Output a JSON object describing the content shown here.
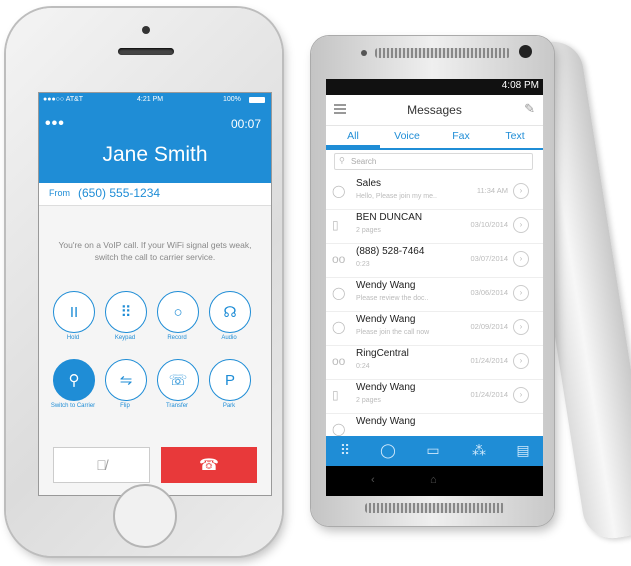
{
  "iphone": {
    "status": {
      "carrier": "●●●○○ AT&T",
      "time": "4:21 PM",
      "battery": "100%"
    },
    "menu_dots": "•••",
    "timer": "00:07",
    "caller_name": "Jane Smith",
    "from_label": "From",
    "from_number": "(650) 555-1234",
    "voip_message": "You're on a VoIP call. If your WiFi signal gets weak, switch the call to carrier service.",
    "controls": [
      {
        "label": "Hold",
        "icon": "pause-icon",
        "glyph": "II"
      },
      {
        "label": "Keypad",
        "icon": "keypad-icon",
        "glyph": "⠿"
      },
      {
        "label": "Record",
        "icon": "record-icon",
        "glyph": "○"
      },
      {
        "label": "Audio",
        "icon": "headphones-icon",
        "glyph": "☊"
      },
      {
        "label": "Switch to Carrier",
        "icon": "antenna-icon",
        "glyph": "⚲"
      },
      {
        "label": "Flip",
        "icon": "flip-icon",
        "glyph": "⇋"
      },
      {
        "label": "Transfer",
        "icon": "transfer-icon",
        "glyph": "☏"
      },
      {
        "label": "Park",
        "icon": "park-icon",
        "glyph": "P"
      }
    ],
    "accent": "#1f8dd6",
    "hangup_color": "#e8393a"
  },
  "android": {
    "status_time": "4:08 PM",
    "title": "Messages",
    "tabs": [
      "All",
      "Voice",
      "Fax",
      "Text"
    ],
    "search_placeholder": "Search",
    "messages": [
      {
        "name": "Sales",
        "sub": "Hello, Please join my me..",
        "date": "11:34 AM",
        "icon": "chat-bubble-icon"
      },
      {
        "name": "BEN DUNCAN",
        "sub": "2 pages",
        "date": "03/10/2014",
        "icon": "fax-document-icon"
      },
      {
        "name": "(888) 528-7464",
        "sub": "0:23",
        "date": "03/07/2014",
        "icon": "voicemail-icon"
      },
      {
        "name": "Wendy Wang",
        "sub": "Please review the doc..",
        "date": "03/06/2014",
        "icon": "chat-bubble-icon"
      },
      {
        "name": "Wendy Wang",
        "sub": "Please join the call now",
        "date": "02/09/2014",
        "icon": "chat-bubble-icon"
      },
      {
        "name": "RingCentral",
        "sub": "0:24",
        "date": "01/24/2014",
        "icon": "voicemail-icon"
      },
      {
        "name": "Wendy Wang",
        "sub": "2 pages",
        "date": "01/24/2014",
        "icon": "fax-document-icon"
      },
      {
        "name": "Wendy Wang",
        "sub": "",
        "date": "",
        "icon": "chat-bubble-icon"
      }
    ]
  }
}
